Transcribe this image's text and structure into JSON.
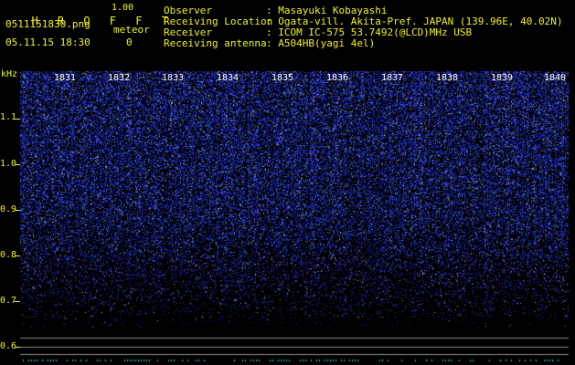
{
  "app": {
    "title": "H R O F F T",
    "version": "1.00",
    "filename": "0511151830.png",
    "datetime": "05.11.15 18:30",
    "meteor_label": "meteor",
    "meteor_count": "0"
  },
  "info": {
    "rows": [
      {
        "label": "Observer",
        "value": ": Masayuki Kobayashi"
      },
      {
        "label": "Receiving Location",
        "value": ": Ogata-vill. Akita-Pref. JAPAN (139.96E, 40.02N)"
      },
      {
        "label": "Receiver",
        "value": ": ICOM IC-575 53.7492(@LCD)MHz USB"
      },
      {
        "label": "Receiving antenna",
        "value": ": A504HB(yagi 4el)"
      }
    ]
  },
  "spectrogram": {
    "y_unit": "kHz",
    "y_ticks": [
      "1.1",
      "1.0",
      "0.9",
      "0.8",
      "0.7",
      "0.6"
    ],
    "minute_labels": [
      "1831",
      "1832",
      "1833",
      "1834",
      "1835",
      "1836",
      "1837",
      "1838",
      "1839",
      "1840"
    ],
    "colors": {
      "noise": "#1a2ad0",
      "label": "#f2f21a",
      "text": "#ffffff"
    }
  }
}
